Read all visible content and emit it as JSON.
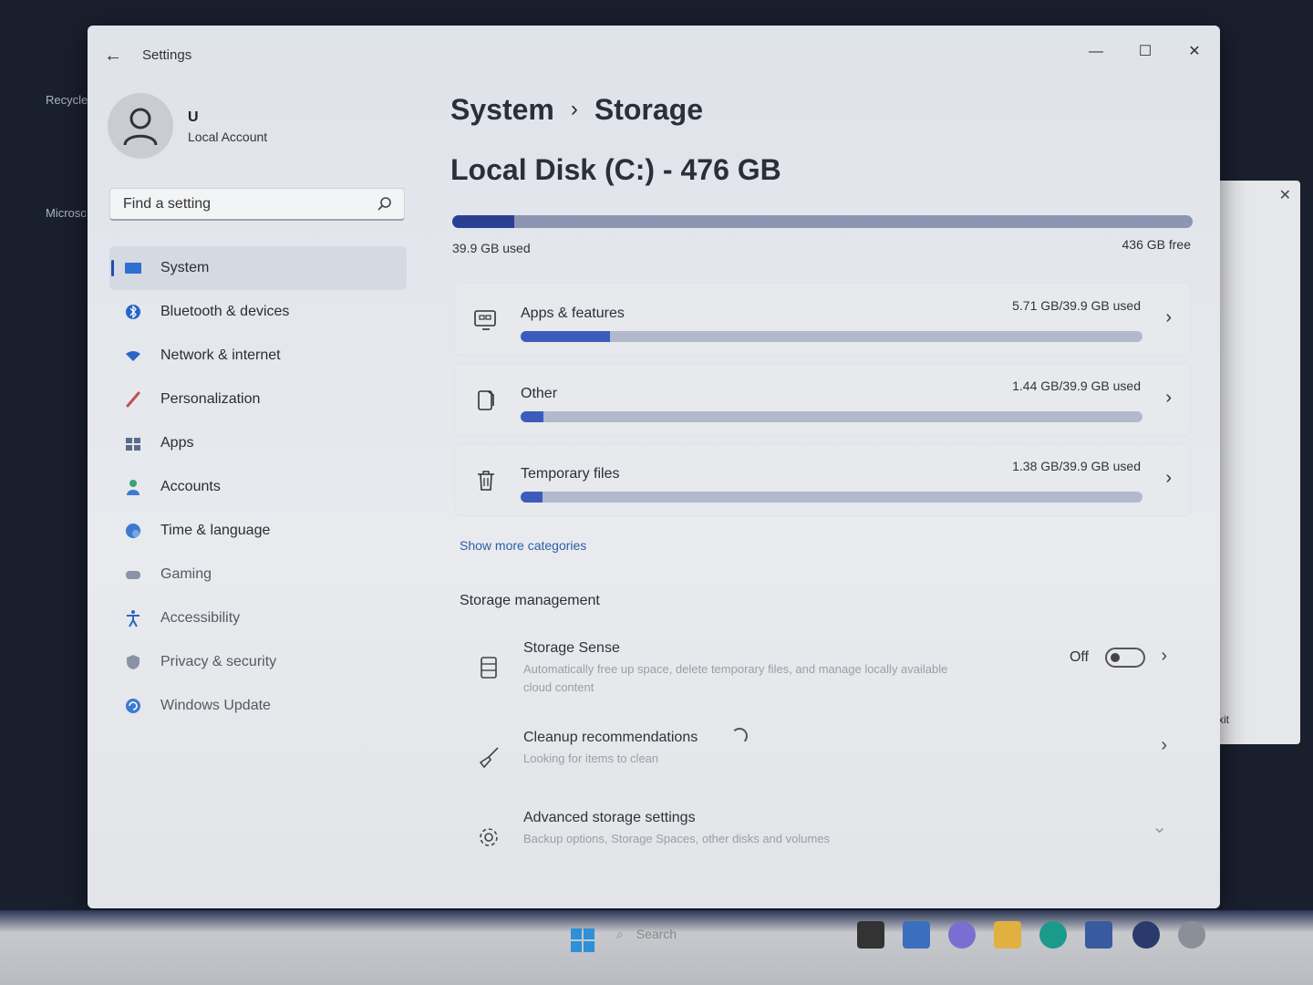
{
  "desktop": {
    "recycle_label": "Recycle",
    "edge_label": "Microsoft Edge"
  },
  "window": {
    "title": "Settings",
    "back_symbol": "←",
    "minimize_symbol": "—",
    "maximize_symbol": "☐",
    "close_symbol": "✕"
  },
  "profile": {
    "name": "U",
    "account_type": "Local Account"
  },
  "search": {
    "placeholder": "Find a setting"
  },
  "nav": {
    "items": [
      {
        "label": "System",
        "icon": "system-icon"
      },
      {
        "label": "Bluetooth & devices",
        "icon": "bluetooth-icon"
      },
      {
        "label": "Network & internet",
        "icon": "wifi-icon"
      },
      {
        "label": "Personalization",
        "icon": "brush-icon"
      },
      {
        "label": "Apps",
        "icon": "apps-icon"
      },
      {
        "label": "Accounts",
        "icon": "person-icon"
      },
      {
        "label": "Time & language",
        "icon": "globe-clock-icon"
      },
      {
        "label": "Gaming",
        "icon": "gamepad-icon"
      },
      {
        "label": "Accessibility",
        "icon": "accessibility-icon"
      },
      {
        "label": "Privacy & security",
        "icon": "shield-icon"
      },
      {
        "label": "Windows Update",
        "icon": "update-icon"
      }
    ],
    "active_index": 0
  },
  "main": {
    "breadcrumb_parent": "System",
    "breadcrumb_sep": "›",
    "breadcrumb_current": "Storage",
    "disk_title": "Local Disk (C:) - 476 GB",
    "disk_used": "39.9 GB used",
    "disk_free": "436 GB free",
    "disk_used_fraction": 0.084,
    "categories": [
      {
        "title": "Apps & features",
        "used": "5.71 GB/39.9 GB used",
        "fraction": 0.143,
        "icon": "apps-features-icon"
      },
      {
        "title": "Other",
        "used": "1.44 GB/39.9 GB used",
        "fraction": 0.036,
        "icon": "other-icon"
      },
      {
        "title": "Temporary files",
        "used": "1.38 GB/39.9 GB used",
        "fraction": 0.035,
        "icon": "trash-icon"
      }
    ],
    "chevron": "›",
    "show_more": "Show more categories",
    "storage_management_title": "Storage management",
    "storage_sense": {
      "title": "Storage Sense",
      "description": "Automatically free up space, delete temporary files, and manage locally available cloud content",
      "toggle_label": "Off",
      "toggle_on": false
    },
    "cleanup": {
      "title": "Cleanup recommendations",
      "description": "Looking for items to clean"
    },
    "advanced": {
      "title": "Advanced storage settings",
      "description": "Backup options, Storage Spaces, other disks and volumes",
      "chevron": "⌄"
    }
  },
  "taskbar": {
    "search_placeholder": "Search"
  },
  "background_window": {
    "close_symbol": "✕",
    "exit_label": "Exit"
  },
  "colors": {
    "accent": "#2a3f92",
    "bar_fill": "#3c5cbd",
    "link": "#2b5fa8"
  }
}
